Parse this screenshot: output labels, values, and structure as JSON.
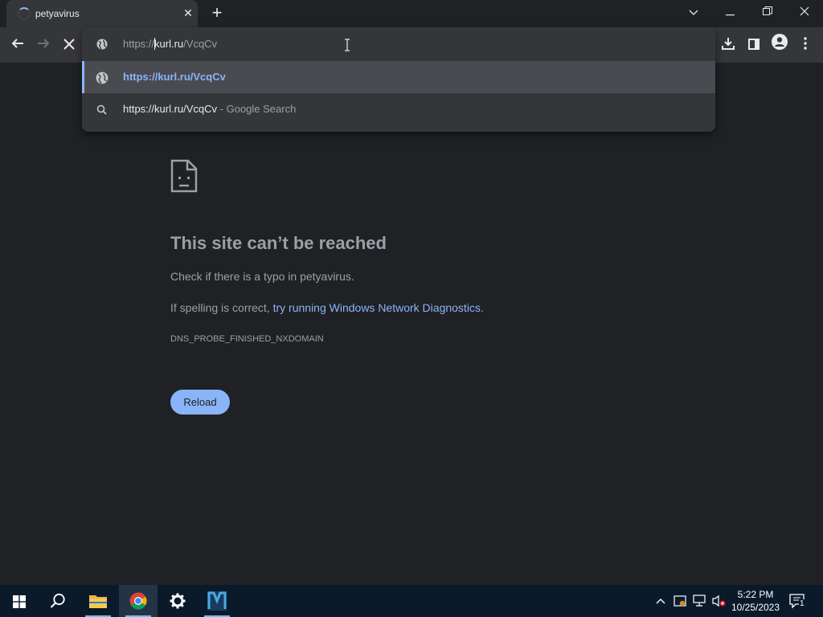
{
  "tab": {
    "title": "petyavirus"
  },
  "omnibox": {
    "value_scheme": "https://",
    "value_host": "kurl.ru",
    "value_path": "/VcqCv",
    "suggestions": [
      {
        "icon": "globe-icon",
        "text": "https://kurl.ru/VcqCv",
        "sub": ""
      },
      {
        "icon": "search-icon",
        "text": "https://kurl.ru/VcqCv",
        "sub": " - Google Search"
      }
    ]
  },
  "error": {
    "title": "This site can’t be reached",
    "line1": "Check if there is a typo in petyavirus.",
    "line2_prefix": "If spelling is correct, ",
    "line2_link": "try running Windows Network Diagnostics",
    "line2_suffix": ".",
    "code": "DNS_PROBE_FINISHED_NXDOMAIN",
    "reload_label": "Reload"
  },
  "taskbar": {
    "time": "5:22 PM",
    "date": "10/25/2023",
    "notification_count": "1",
    "apps": [
      "start-icon",
      "search-icon",
      "file-explorer-icon",
      "chrome-icon",
      "settings-icon",
      "app-m-icon"
    ]
  },
  "colors": {
    "accent": "#8ab4f8",
    "background": "#202124",
    "surface": "#35363a"
  }
}
